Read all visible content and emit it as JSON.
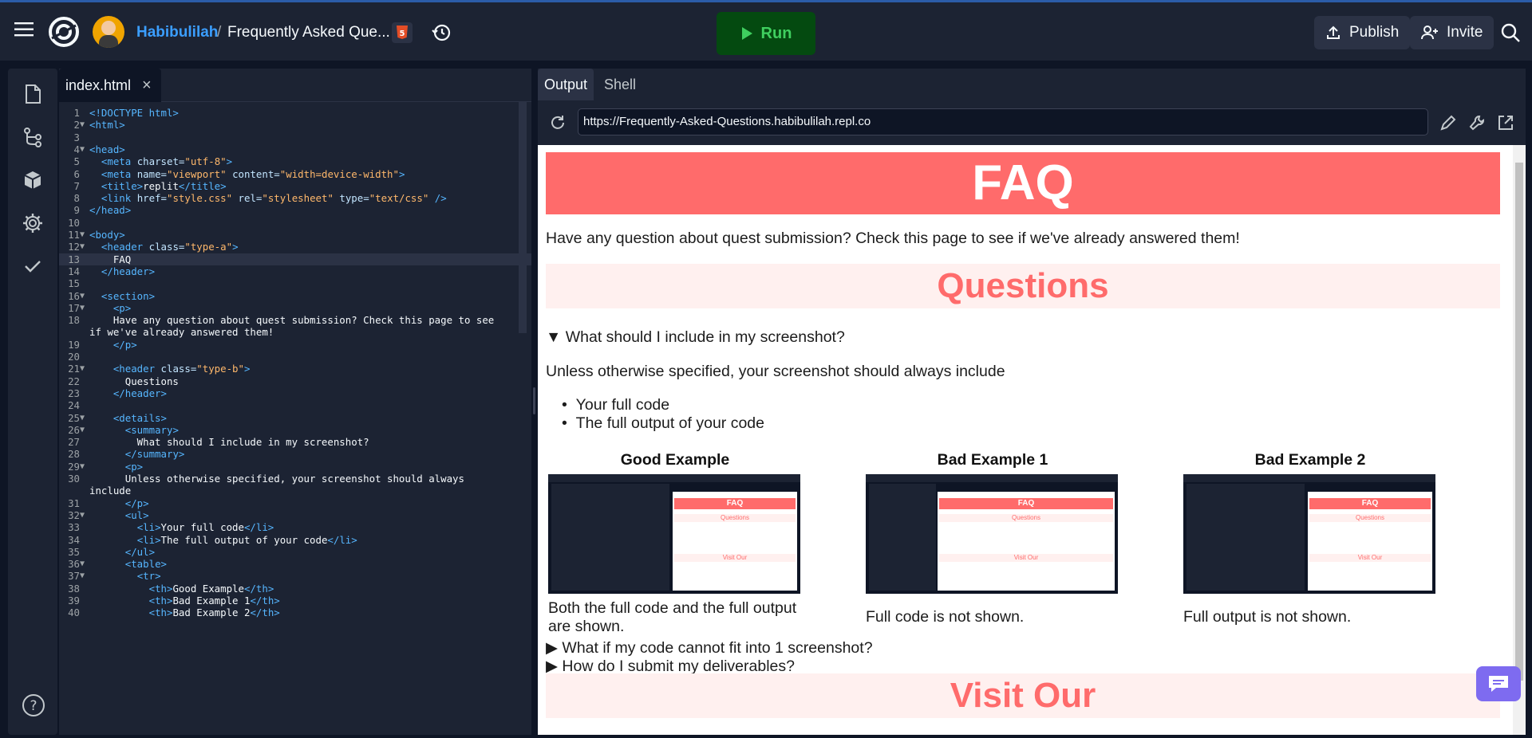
{
  "topbar": {
    "user": "Habibulilah",
    "separator": "/",
    "project": "Frequently Asked Que...",
    "run_label": "Run",
    "publish_label": "Publish",
    "invite_label": "Invite"
  },
  "editor": {
    "tab_label": "index.html",
    "close_glyph": "×"
  },
  "output": {
    "tabs": [
      "Output",
      "Shell"
    ],
    "url": "https://Frequently-Asked-Questions.habibulilah.repl.co"
  },
  "page": {
    "title": "FAQ",
    "intro": "Have any question about quest submission? Check this page to see if we've already answered them!",
    "questions_header": "Questions",
    "q1": "What should I include in my screenshot?",
    "q1_text": "Unless otherwise specified, your screenshot should always include",
    "q1_items": [
      "Your full code",
      "The full output of your code"
    ],
    "examples": [
      {
        "head": "Good Example",
        "caption": "Both the full code and the full output are shown."
      },
      {
        "head": "Bad Example 1",
        "caption": "Full code is not shown."
      },
      {
        "head": "Bad Example 2",
        "caption": "Full output is not shown."
      }
    ],
    "q2": "What if my code cannot fit into 1 screenshot?",
    "q3": "How do I submit my deliverables?",
    "visit_header": "Visit Our",
    "thumb_title": "FAQ",
    "thumb_questions": "Questions",
    "thumb_visit": "Visit Our"
  },
  "code_lines": [
    {
      "n": "1",
      "f": "",
      "html": "<span class='t-tag'>&lt;!DOCTYPE html&gt;</span>"
    },
    {
      "n": "2",
      "f": "▼",
      "html": "<span class='t-tag'>&lt;html&gt;</span>"
    },
    {
      "n": "3",
      "f": "",
      "html": ""
    },
    {
      "n": "4",
      "f": "▼",
      "html": "<span class='t-tag'>&lt;head&gt;</span>"
    },
    {
      "n": "5",
      "f": "",
      "html": "  <span class='t-tag'>&lt;meta</span> <span class='t-attr'>charset=</span><span class='t-str'>\"utf-8\"</span><span class='t-tag'>&gt;</span>"
    },
    {
      "n": "6",
      "f": "",
      "html": "  <span class='t-tag'>&lt;meta</span> <span class='t-attr'>name=</span><span class='t-str'>\"viewport\"</span> <span class='t-attr'>content=</span><span class='t-str'>\"width=device-width\"</span><span class='t-tag'>&gt;</span>"
    },
    {
      "n": "7",
      "f": "",
      "html": "  <span class='t-tag'>&lt;title&gt;</span>replit<span class='t-tag'>&lt;/title&gt;</span>"
    },
    {
      "n": "8",
      "f": "",
      "html": "  <span class='t-tag'>&lt;link</span> <span class='t-attr'>href=</span><span class='t-str'>\"style.css\"</span> <span class='t-attr'>rel=</span><span class='t-str'>\"stylesheet\"</span> <span class='t-attr'>type=</span><span class='t-str'>\"text/css\"</span> <span class='t-tag'>/&gt;</span>"
    },
    {
      "n": "9",
      "f": "",
      "html": "<span class='t-tag'>&lt;/head&gt;</span>"
    },
    {
      "n": "10",
      "f": "",
      "html": ""
    },
    {
      "n": "11",
      "f": "▼",
      "html": "<span class='t-tag'>&lt;body&gt;</span>"
    },
    {
      "n": "12",
      "f": "▼",
      "html": "  <span class='t-tag'>&lt;header</span> <span class='t-attr'>class=</span><span class='t-str'>\"type-a\"</span><span class='t-tag'>&gt;</span>"
    },
    {
      "n": "13",
      "f": "",
      "html": "    FAQ",
      "active": true
    },
    {
      "n": "14",
      "f": "",
      "html": "  <span class='t-tag'>&lt;/header&gt;</span>"
    },
    {
      "n": "15",
      "f": "",
      "html": ""
    },
    {
      "n": "16",
      "f": "▼",
      "html": "  <span class='t-tag'>&lt;section&gt;</span>"
    },
    {
      "n": "17",
      "f": "▼",
      "html": "    <span class='t-tag'>&lt;p&gt;</span>"
    },
    {
      "n": "18",
      "f": "",
      "html": "    Have any question about quest submission? Check this page to see"
    },
    {
      "n": "",
      "f": "",
      "html": "if we've already answered them!"
    },
    {
      "n": "19",
      "f": "",
      "html": "    <span class='t-tag'>&lt;/p&gt;</span>"
    },
    {
      "n": "20",
      "f": "",
      "html": ""
    },
    {
      "n": "21",
      "f": "▼",
      "html": "    <span class='t-tag'>&lt;header</span> <span class='t-attr'>class=</span><span class='t-str'>\"type-b\"</span><span class='t-tag'>&gt;</span>"
    },
    {
      "n": "22",
      "f": "",
      "html": "      Questions"
    },
    {
      "n": "23",
      "f": "",
      "html": "    <span class='t-tag'>&lt;/header&gt;</span>"
    },
    {
      "n": "24",
      "f": "",
      "html": ""
    },
    {
      "n": "25",
      "f": "▼",
      "html": "    <span class='t-tag'>&lt;details&gt;</span>"
    },
    {
      "n": "26",
      "f": "▼",
      "html": "      <span class='t-tag'>&lt;summary&gt;</span>"
    },
    {
      "n": "27",
      "f": "",
      "html": "        What should I include in my screenshot?"
    },
    {
      "n": "28",
      "f": "",
      "html": "      <span class='t-tag'>&lt;/summary&gt;</span>"
    },
    {
      "n": "29",
      "f": "▼",
      "html": "      <span class='t-tag'>&lt;p&gt;</span>"
    },
    {
      "n": "30",
      "f": "",
      "html": "      Unless otherwise specified, your screenshot should always"
    },
    {
      "n": "",
      "f": "",
      "html": "include"
    },
    {
      "n": "31",
      "f": "",
      "html": "      <span class='t-tag'>&lt;/p&gt;</span>"
    },
    {
      "n": "32",
      "f": "▼",
      "html": "      <span class='t-tag'>&lt;ul&gt;</span>"
    },
    {
      "n": "33",
      "f": "",
      "html": "        <span class='t-tag'>&lt;li&gt;</span>Your full code<span class='t-tag'>&lt;/li&gt;</span>"
    },
    {
      "n": "34",
      "f": "",
      "html": "        <span class='t-tag'>&lt;li&gt;</span>The full output of your code<span class='t-tag'>&lt;/li&gt;</span>"
    },
    {
      "n": "35",
      "f": "",
      "html": "      <span class='t-tag'>&lt;/ul&gt;</span>"
    },
    {
      "n": "36",
      "f": "▼",
      "html": "      <span class='t-tag'>&lt;table&gt;</span>"
    },
    {
      "n": "37",
      "f": "▼",
      "html": "        <span class='t-tag'>&lt;tr&gt;</span>"
    },
    {
      "n": "38",
      "f": "",
      "html": "          <span class='t-tag'>&lt;th&gt;</span>Good Example<span class='t-tag'>&lt;/th&gt;</span>"
    },
    {
      "n": "39",
      "f": "",
      "html": "          <span class='t-tag'>&lt;th&gt;</span>Bad Example 1<span class='t-tag'>&lt;/th&gt;</span>"
    },
    {
      "n": "40",
      "f": "",
      "html": "          <span class='t-tag'>&lt;th&gt;</span>Bad Example 2<span class='t-tag'>&lt;/th&gt;</span>"
    }
  ],
  "colors": {
    "accent": "#ff6b6b",
    "run_bg": "#044a10",
    "run_fg": "#3fcf5f",
    "user_link": "#3b9eff"
  }
}
